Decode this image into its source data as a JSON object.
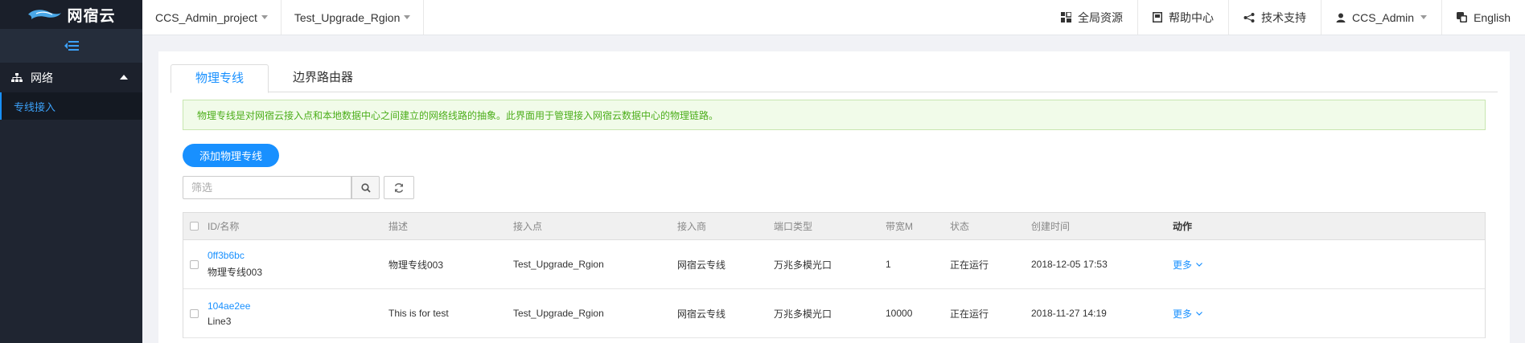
{
  "brand": {
    "name": "网宿云"
  },
  "sidebar": {
    "group_label": "网络",
    "sub_item": "专线接入"
  },
  "topbar": {
    "project": "CCS_Admin_project",
    "region": "Test_Upgrade_Rgion",
    "global_resources": "全局资源",
    "help_center": "帮助中心",
    "tech_support": "技术支持",
    "user": "CCS_Admin",
    "language": "English"
  },
  "tabs": [
    "物理专线",
    "边界路由器"
  ],
  "notice": "物理专线是对网宿云接入点和本地数据中心之间建立的网络线路的抽象。此界面用于管理接入网宿云数据中心的物理链路。",
  "add_button": "添加物理专线",
  "search": {
    "placeholder": "筛选"
  },
  "table": {
    "headers": {
      "id_name": "ID/名称",
      "desc": "描述",
      "access_point": "接入点",
      "provider": "接入商",
      "port_type": "端口类型",
      "bandwidth": "带宽M",
      "status": "状态",
      "created": "创建时间",
      "actions": "动作"
    },
    "rows": [
      {
        "id": "0ff3b6bc",
        "name": "物理专线003",
        "desc": "物理专线003",
        "access_point": "Test_Upgrade_Rgion",
        "provider": "网宿云专线",
        "port_type": "万兆多模光口",
        "bandwidth": "1",
        "status": "正在运行",
        "created": "2018-12-05 17:53",
        "action": "更多"
      },
      {
        "id": "104ae2ee",
        "name": "Line3",
        "desc": "This is for test",
        "access_point": "Test_Upgrade_Rgion",
        "provider": "网宿云专线",
        "port_type": "万兆多模光口",
        "bandwidth": "10000",
        "status": "正在运行",
        "created": "2018-11-27 14:19",
        "action": "更多"
      }
    ]
  },
  "colors": {
    "accent": "#1890ff",
    "sidebar": "#1f2531",
    "notice_text": "#4cae1a"
  }
}
